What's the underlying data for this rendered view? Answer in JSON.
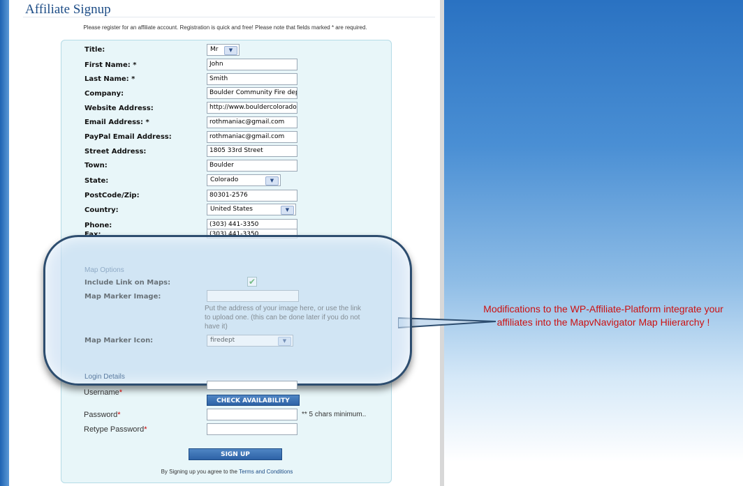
{
  "header": {
    "title": "Affiliate Signup",
    "intro": "Please register for an affiliate account. Registration is quick and free! Please note that fields marked * are required."
  },
  "form": {
    "title": {
      "label": "Title:",
      "value": "Mr"
    },
    "first_name": {
      "label": "First Name: *",
      "value": "John"
    },
    "last_name": {
      "label": "Last Name: *",
      "value": "Smith"
    },
    "company": {
      "label": "Company:",
      "value": "Boulder Community Fire dept"
    },
    "website": {
      "label": "Website Address:",
      "value": "http://www.bouldercolorado.gov"
    },
    "email": {
      "label": "Email Address: *",
      "value": "rothmaniac@gmail.com"
    },
    "paypal": {
      "label": "PayPal Email Address:",
      "value": "rothmaniac@gmail.com"
    },
    "street": {
      "label": "Street Address:",
      "value": "1805 33rd Street"
    },
    "town": {
      "label": "Town:",
      "value": "Boulder"
    },
    "state": {
      "label": "State:",
      "value": "Colorado"
    },
    "postcode": {
      "label": "PostCode/Zip:",
      "value": "80301-2576"
    },
    "country": {
      "label": "Country:",
      "value": "United States"
    },
    "phone": {
      "label": "Phone:",
      "value": "(303) 441-3350"
    },
    "fax": {
      "label": "Fax:",
      "value": "(303) 441-3350"
    }
  },
  "map_options": {
    "heading": "Map Options",
    "include_link": {
      "label": "Include Link on Maps:",
      "checked": true
    },
    "marker_image": {
      "label": "Map Marker Image:",
      "value": "",
      "help": "Put the address of your image here, or use the link to upload one. (this can be done later if you do not have it)"
    },
    "marker_icon": {
      "label": "Map Marker Icon:",
      "value": "firedept"
    }
  },
  "login": {
    "heading": "Login Details",
    "username_label": "Username",
    "username_value": "",
    "check_button": "CHECK AVAILABILITY",
    "password_label": "Password",
    "password_hint": "** 5 chars minimum..",
    "retype_label": "Retype Password",
    "required_mark": "*"
  },
  "signup_button": "SIGN UP",
  "terms_prefix": "By Signing up you agree to the",
  "terms_link": "Terms and Conditions",
  "callout": "Modifications to the WP-Affiliate-Platform integrate your affiliates into the MapvNavigator Map Hiierarchy !",
  "colors": {
    "panel": "#e8f6f9",
    "button": "#2d62a6",
    "callout_text": "#cc1111",
    "title_text": "#1c4c86"
  }
}
